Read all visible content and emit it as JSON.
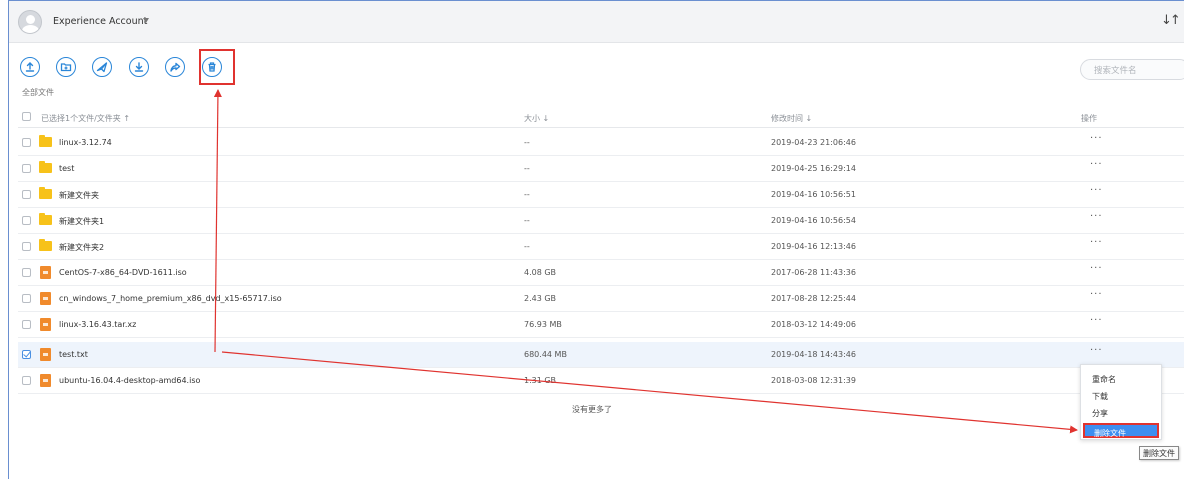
{
  "header": {
    "account_name": "Experience Account",
    "caret": "▼",
    "sort_icon": "↓↑"
  },
  "toolbar": {
    "buttons": [
      {
        "icon": "upload-icon"
      },
      {
        "icon": "new-folder-icon"
      },
      {
        "icon": "send-icon"
      },
      {
        "icon": "download-icon"
      },
      {
        "icon": "share-icon"
      },
      {
        "icon": "trash-icon"
      }
    ],
    "accent": "#2a86d8",
    "breadcrumb": "全部文件",
    "search_placeholder": "搜索文件名"
  },
  "table": {
    "headers": {
      "name": "已选择1个文件/文件夹 ↑",
      "size": "大小 ↓",
      "modified": "修改时间 ↓",
      "actions": "操作"
    },
    "rows": [
      {
        "type": "folder",
        "name": "linux-3.12.74",
        "size": "--",
        "modified": "2019-04-23 21:06:46",
        "more": "···",
        "selected": false
      },
      {
        "type": "folder",
        "name": "test",
        "size": "--",
        "modified": "2019-04-25 16:29:14",
        "more": "···",
        "selected": false
      },
      {
        "type": "folder",
        "name": "新建文件夹",
        "size": "--",
        "modified": "2019-04-16 10:56:51",
        "more": "···",
        "selected": false
      },
      {
        "type": "folder",
        "name": "新建文件夹1",
        "size": "--",
        "modified": "2019-04-16 10:56:54",
        "more": "···",
        "selected": false
      },
      {
        "type": "folder",
        "name": "新建文件夹2",
        "size": "--",
        "modified": "2019-04-16 12:13:46",
        "more": "···",
        "selected": false
      },
      {
        "type": "file",
        "name": "CentOS-7-x86_64-DVD-1611.iso",
        "size": "4.08 GB",
        "modified": "2017-06-28 11:43:36",
        "more": "···",
        "selected": false
      },
      {
        "type": "file",
        "name": "cn_windows_7_home_premium_x86_dvd_x15-65717.iso",
        "size": "2.43 GB",
        "modified": "2017-08-28 12:25:44",
        "more": "···",
        "selected": false
      },
      {
        "type": "file",
        "name": "linux-3.16.43.tar.xz",
        "size": "76.93 MB",
        "modified": "2018-03-12 14:49:06",
        "more": "···",
        "selected": false
      },
      {
        "type": "file",
        "name": "test.txt",
        "size": "680.44 MB",
        "modified": "2019-04-18 14:43:46",
        "more": "···",
        "selected": true
      },
      {
        "type": "file",
        "name": "ubuntu-16.04.4-desktop-amd64.iso",
        "size": "1.31 GB",
        "modified": "2018-03-08 12:31:39",
        "more": "···",
        "selected": false
      }
    ],
    "footer": "没有更多了"
  },
  "context_menu": {
    "items": [
      "重命名",
      "下载",
      "分享",
      "删除文件"
    ],
    "active_index": 3,
    "tooltip": "删除文件"
  },
  "annotation_color": "#e0332f"
}
